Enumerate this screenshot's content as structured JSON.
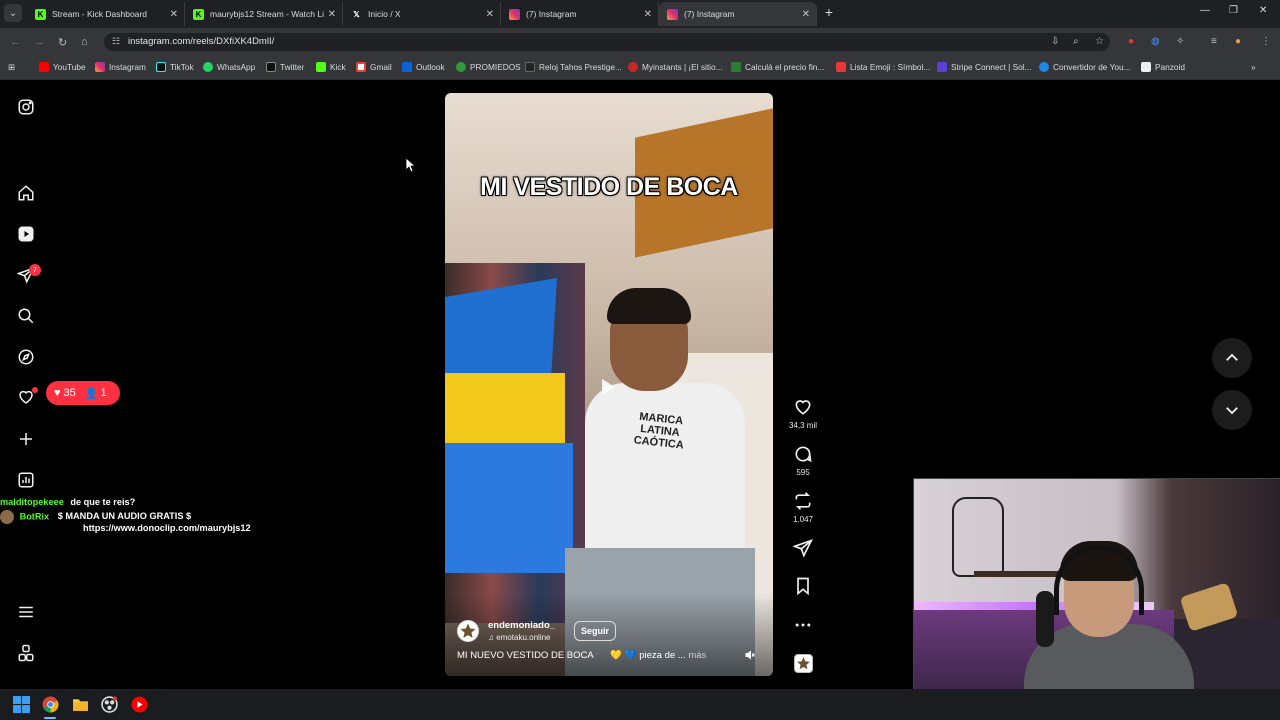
{
  "browser": {
    "tabs": [
      {
        "title": "Stream - Kick Dashboard",
        "favicon": "kick-icon",
        "color": "#53fc18"
      },
      {
        "title": "maurybjs12 Stream - Watch Live",
        "favicon": "kick-icon",
        "color": "#53fc18"
      },
      {
        "title": "Inicio / X",
        "favicon": "x-icon",
        "color": "#000000"
      },
      {
        "title": "(7) Instagram",
        "favicon": "instagram-icon",
        "color": "#e1306c"
      },
      {
        "title": "(7) Instagram",
        "favicon": "instagram-icon",
        "color": "#e1306c"
      }
    ],
    "url": "instagram.com/reels/DXfiXK4DmlI/",
    "bookmarks": [
      {
        "label": "YouTube",
        "icon": "youtube-icon",
        "color": "#ff0000"
      },
      {
        "label": "Instagram",
        "icon": "instagram-icon",
        "color": "#e1306c"
      },
      {
        "label": "TikTok",
        "icon": "tiktok-icon",
        "color": "#111111"
      },
      {
        "label": "WhatsApp",
        "icon": "whatsapp-icon",
        "color": "#25d366"
      },
      {
        "label": "Twitter",
        "icon": "x-icon",
        "color": "#111111"
      },
      {
        "label": "Kick",
        "icon": "kick-icon",
        "color": "#53fc18"
      },
      {
        "label": "Gmail",
        "icon": "gmail-icon",
        "color": "#ea4335"
      },
      {
        "label": "Outlook",
        "icon": "outlook-icon",
        "color": "#0a64d8"
      },
      {
        "label": "PROMIEDOS",
        "icon": "promiedos-icon",
        "color": "#2e9b3a"
      },
      {
        "label": "Reloj Tahos Prestige...",
        "icon": "watch-icon",
        "color": "#222222"
      },
      {
        "label": "Myinstants | ¡El sitio...",
        "icon": "myinstants-icon",
        "color": "#c62828"
      },
      {
        "label": "Calculá el precio fin...",
        "icon": "calculator-icon",
        "color": "#2e7d32"
      },
      {
        "label": "Lista Emoji : Símbol...",
        "icon": "emoji-icon",
        "color": "#e53935"
      },
      {
        "label": "Stripe Connect | Sol...",
        "icon": "stripe-icon",
        "color": "#5b3fd6"
      },
      {
        "label": "Convertidor de You...",
        "icon": "converter-icon",
        "color": "#1e88e5"
      },
      {
        "label": "Panzoid",
        "icon": "panzoid-icon",
        "color": "#eeeeee"
      }
    ]
  },
  "sidebar": {
    "notifications_badge": "7",
    "activity": {
      "likes": "35",
      "follows": "1"
    }
  },
  "chat": {
    "messages": [
      {
        "user": "malditopekeee",
        "text": "de que te reis?",
        "user_color": "#53fc18"
      },
      {
        "user": "BotRix",
        "text": "$ MANDA UN AUDIO GRATIS $",
        "link": "https://www.donoclip.com/maurybjs12",
        "user_color": "#53fc18"
      }
    ]
  },
  "reel": {
    "overlay_title": "MI VESTIDO DE BOCA",
    "shirt_text": "MARICA LATINA CAÓTICA",
    "username": "endemoniado_",
    "subline": "emotaku.online",
    "follow_label": "Seguir",
    "caption": "MI NUEVO VESTIDO DE BOCA ➖ 💛 💙 pieza de ...",
    "more_label": "más",
    "likes": "34,3 mil",
    "comments": "595",
    "reposts": "1.047"
  },
  "colors": {
    "accent_red": "#ff3040",
    "boca_blue": "#1f6fd0",
    "boca_yellow": "#f2c91a"
  }
}
